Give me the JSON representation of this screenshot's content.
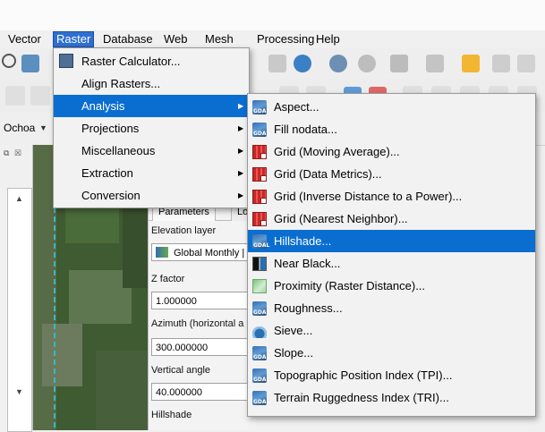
{
  "menubar": {
    "items": [
      {
        "label": "Vector",
        "active": false
      },
      {
        "label": "Raster",
        "active": true
      },
      {
        "label": "Database",
        "active": false
      },
      {
        "label": "Web",
        "active": false
      },
      {
        "label": "Mesh",
        "active": false
      },
      {
        "label": "Processing",
        "active": false
      },
      {
        "label": "Help",
        "active": false
      }
    ]
  },
  "toolbar": {
    "layer_selector_value": "Ochoa"
  },
  "raster_menu": {
    "items": [
      {
        "label": "Raster Calculator...",
        "icon": "raster-calculator-icon",
        "submenu": false
      },
      {
        "label": "Align Rasters...",
        "icon": "",
        "submenu": false
      },
      {
        "label": "Analysis",
        "icon": "",
        "submenu": true,
        "selected": true
      },
      {
        "label": "Projections",
        "icon": "",
        "submenu": true
      },
      {
        "label": "Miscellaneous",
        "icon": "",
        "submenu": true
      },
      {
        "label": "Extraction",
        "icon": "",
        "submenu": true
      },
      {
        "label": "Conversion",
        "icon": "",
        "submenu": true
      }
    ]
  },
  "analysis_menu": {
    "items": [
      {
        "label": "Aspect...",
        "icon": "gdal-icon"
      },
      {
        "label": "Fill nodata...",
        "icon": "gdal-icon"
      },
      {
        "label": "Grid (Moving Average)...",
        "icon": "grid-icon"
      },
      {
        "label": "Grid (Data Metrics)...",
        "icon": "grid-icon"
      },
      {
        "label": "Grid (Inverse Distance to a Power)...",
        "icon": "grid-icon"
      },
      {
        "label": "Grid (Nearest Neighbor)...",
        "icon": "grid-icon"
      },
      {
        "label": "Hillshade...",
        "icon": "gdal-icon",
        "selected": true
      },
      {
        "label": "Near Black...",
        "icon": "near-black-icon"
      },
      {
        "label": "Proximity (Raster Distance)...",
        "icon": "proximity-icon"
      },
      {
        "label": "Roughness...",
        "icon": "gdal-icon"
      },
      {
        "label": "Sieve...",
        "icon": "sieve-icon"
      },
      {
        "label": "Slope...",
        "icon": "gdal-icon"
      },
      {
        "label": "Topographic Position Index (TPI)...",
        "icon": "gdal-icon"
      },
      {
        "label": "Terrain Ruggedness Index (TRI)...",
        "icon": "gdal-icon"
      }
    ],
    "gdal_badge": "GDAL"
  },
  "dialog": {
    "tabs": [
      "Parameters",
      "Lo"
    ],
    "elevation_label": "Elevation layer",
    "elevation_value": "Global Monthly |",
    "zfactor_label": "Z factor",
    "zfactor_value": "1.000000",
    "azimuth_label": "Azimuth (horizontal a",
    "azimuth_value": "300.000000",
    "vertical_label": "Vertical angle",
    "vertical_value": "40.000000",
    "hillshade_label": "Hillshade"
  },
  "colors": {
    "menu_highlight": "#0a6ed1",
    "menubar_active": "#2f6fd0"
  }
}
